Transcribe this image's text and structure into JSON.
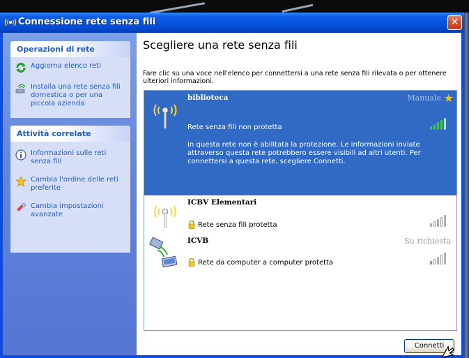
{
  "window": {
    "title": "Connessione rete senza fili",
    "close_glyph": "✕"
  },
  "sidebar": {
    "network_tasks": {
      "header": "Operazioni di rete",
      "items": [
        {
          "label": "Aggiorna elenco reti",
          "icon": "refresh-icon"
        },
        {
          "label": "Installa una rete senza fili domestica o per una piccola azienda",
          "icon": "setup-wireless-icon"
        }
      ]
    },
    "related_tasks": {
      "header": "Attività correlate",
      "items": [
        {
          "label": "Informazioni sulle reti senza fili",
          "icon": "info-icon"
        },
        {
          "label": "Cambia l'ordine delle reti preferite",
          "icon": "star-icon"
        },
        {
          "label": "Cambia impostazioni avanzate",
          "icon": "settings-icon"
        }
      ]
    }
  },
  "main": {
    "title": "Scegliere una rete senza fili",
    "instructions": "Fare clic su una voce nell'elenco per connettersi a una rete senza fili rilevata o per ottenere ulteriori informazioni.",
    "networks": [
      {
        "name": "biblioteca",
        "status": "Rete senza fili non protetta",
        "mode": "Manuale",
        "selected": true,
        "signal_bars": 4,
        "warning": "In questa rete non è abilitata la protezione. Le informazioni inviate attraverso questa rete potrebbero essere visibili ad altri utenti. Per connettersi a questa rete, scegliere Connetti."
      },
      {
        "name": "ICBV Elementari",
        "status": "Rete senza fili protetta",
        "mode": "",
        "selected": false,
        "signal_bars": 0
      },
      {
        "name": "ICVB",
        "status": "Rete da computer a computer protetta",
        "mode": "Su richiesta",
        "selected": false,
        "signal_bars": 1
      }
    ],
    "connect_button": "Connetti"
  },
  "colors": {
    "title_bar": "#0453de",
    "selection": "#316ac5",
    "signal_on": "#3fc93f",
    "signal_off": "#d0d0d0"
  }
}
